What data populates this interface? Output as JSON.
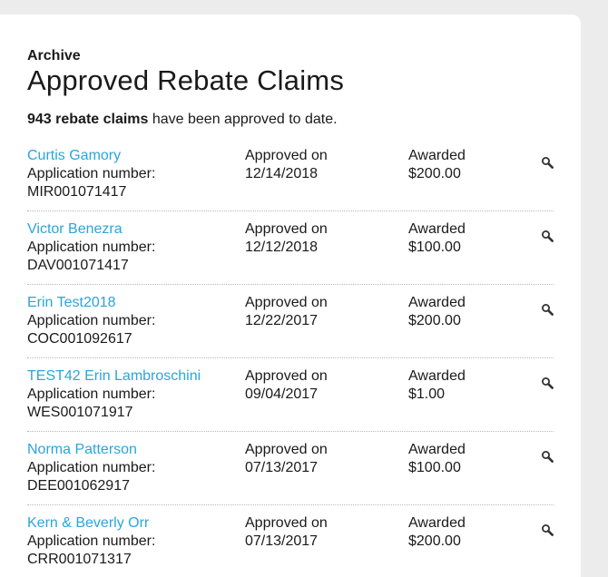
{
  "header": {
    "eyebrow": "Archive",
    "title": "Approved Rebate Claims"
  },
  "summary": {
    "count_text": "943 rebate claims",
    "rest_text": " have been approved to date."
  },
  "labels": {
    "application_number": "Application number:",
    "approved_on": "Approved on",
    "awarded": "Awarded"
  },
  "claims": [
    {
      "name": "Curtis Gamory",
      "app_number": "MIR001071417",
      "date": "12/14/2018",
      "amount": "$200.00"
    },
    {
      "name": "Victor Benezra",
      "app_number": "DAV001071417",
      "date": "12/12/2018",
      "amount": "$100.00"
    },
    {
      "name": "Erin Test2018",
      "app_number": "COC001092617",
      "date": "12/22/2017",
      "amount": "$200.00"
    },
    {
      "name": "TEST42 Erin Lambroschini",
      "app_number": "WES001071917",
      "date": "09/04/2017",
      "amount": "$1.00"
    },
    {
      "name": "Norma Patterson",
      "app_number": "DEE001062917",
      "date": "07/13/2017",
      "amount": "$100.00"
    },
    {
      "name": "Kern & Beverly Orr",
      "app_number": "CRR001071317",
      "date": "07/13/2017",
      "amount": "$200.00"
    }
  ],
  "colors": {
    "link": "#2aa5dc",
    "background": "#ececec",
    "card": "#ffffff"
  },
  "icons": {
    "view": "magnifier-icon"
  }
}
